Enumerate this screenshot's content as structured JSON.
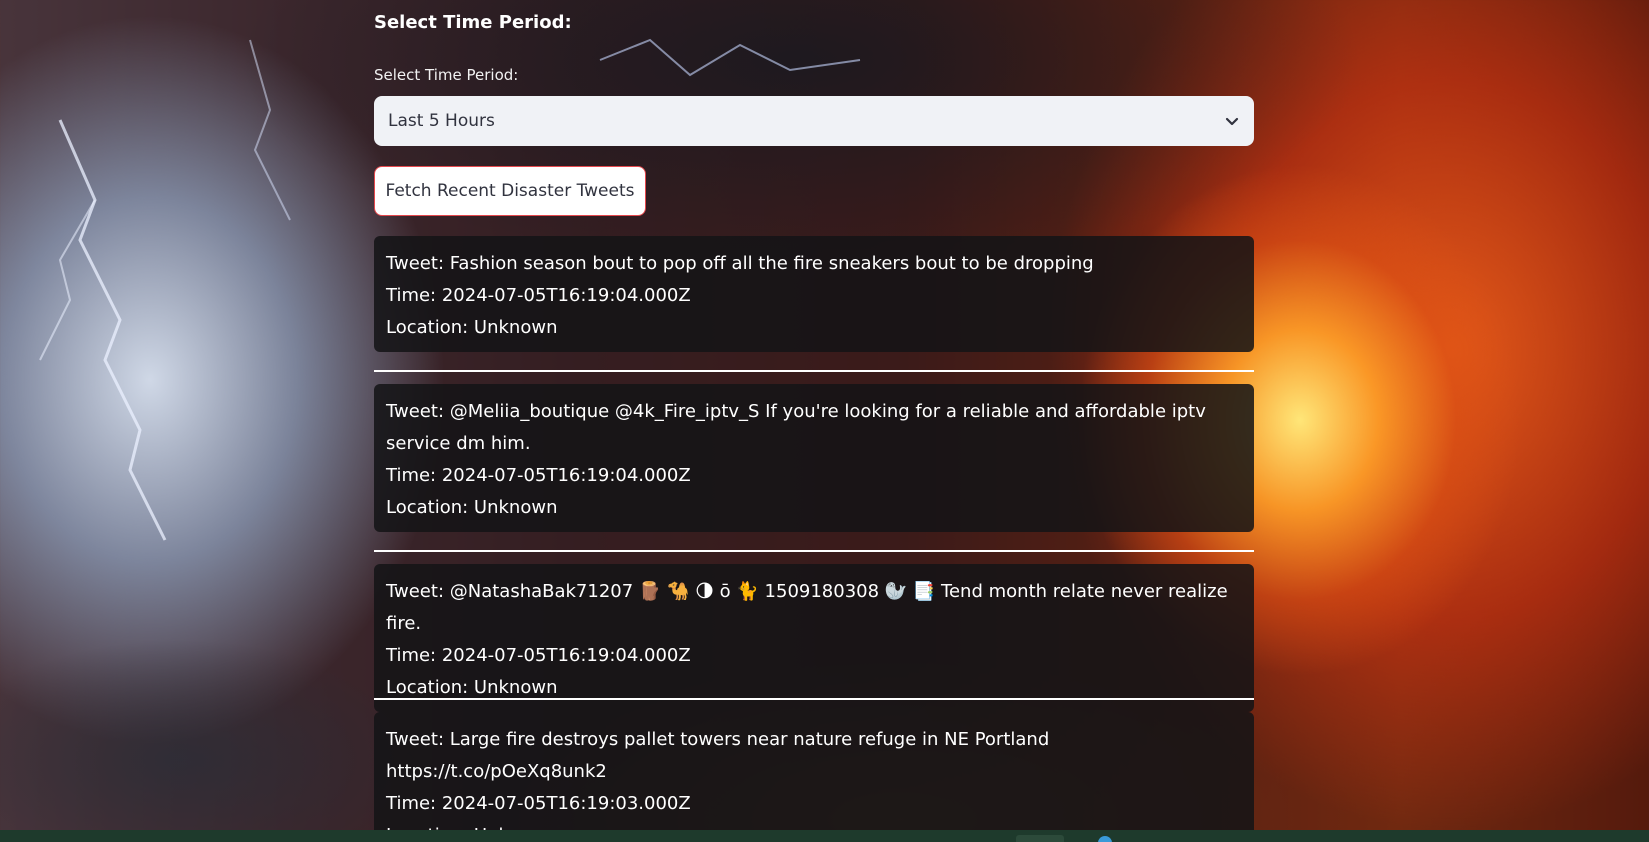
{
  "header": {
    "section_title": "Select Time Period:"
  },
  "time_select": {
    "label": "Select Time Period:",
    "selected": "Last 5 Hours"
  },
  "fetch_button": {
    "label": "Fetch Recent Disaster Tweets",
    "border_color": "#e5484d"
  },
  "tweets": [
    {
      "tweet": "Tweet: Fashion season bout to pop off all the fire sneakers bout to be dropping",
      "time": "Time: 2024-07-05T16:19:04.000Z",
      "location": "Location: Unknown"
    },
    {
      "tweet": "Tweet: @Meliia_boutique @4k_Fire_iptv_S If you're looking for a reliable and affordable iptv service dm him.",
      "time": "Time: 2024-07-05T16:19:04.000Z",
      "location": "Location: Unknown"
    },
    {
      "tweet": "Tweet: @NatashaBak71207 🪵 🐪 🌗 ō 🐈 1509180308 🦭 📑 Tend month relate never realize fire.",
      "time": "Time: 2024-07-05T16:19:04.000Z",
      "location": "Location: Unknown"
    },
    {
      "tweet": "Tweet: Large fire destroys pallet towers near nature refuge in NE Portland https://t.co/pOeXq8unk2",
      "time": "Time: 2024-07-05T16:19:03.000Z",
      "location": "Location: Unknown"
    }
  ],
  "icons": {
    "select_chevron": "chevron-down-icon"
  },
  "colors": {
    "card_background": "rgba(20,20,22,0.86)",
    "select_background": "#f0f2f6",
    "divider": "#ffffff"
  }
}
